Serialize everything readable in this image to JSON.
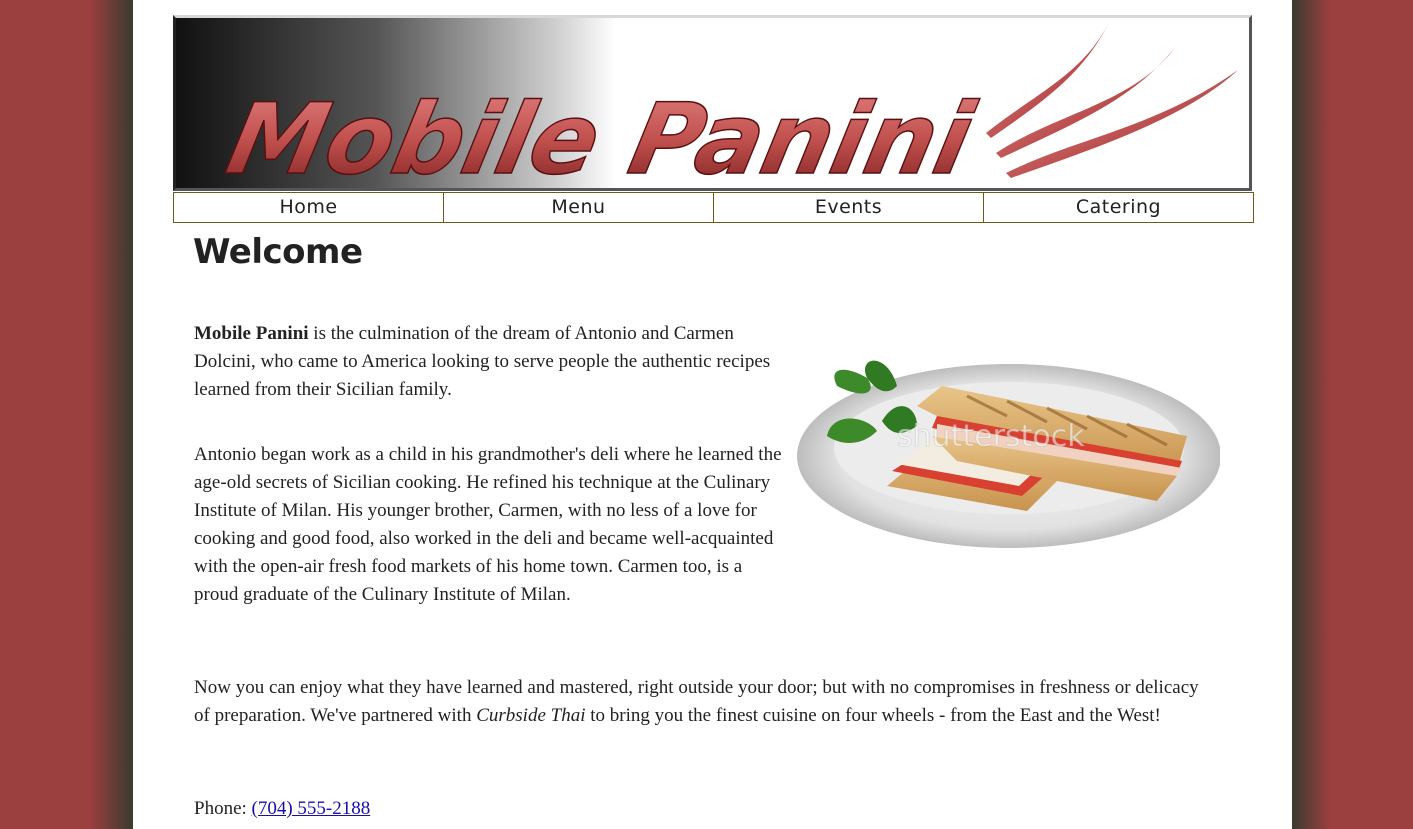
{
  "banner": {
    "logo_text": "Mobile Panini"
  },
  "nav": {
    "items": [
      {
        "label": "Home"
      },
      {
        "label": "Menu"
      },
      {
        "label": "Events"
      },
      {
        "label": "Catering"
      }
    ]
  },
  "main": {
    "title": "Welcome",
    "p1_bold": "Mobile Panini",
    "p1_rest": " is the culmination of the dream of Antonio and Carmen Dolcini, who came to America looking to serve people the authentic recipes learned from their Sicilian family.",
    "p2": "Antonio began work as a child in his grandmother's deli where he learned the age-old secrets of Sicilian cooking. He refined his technique at the Culinary Institute of Milan. His younger brother, Carmen, with no less of a love for cooking and good food, also worked in the deli and became well-acquainted with the open-air fresh food markets of his home town. Carmen too, is a proud graduate of the Culinary Institute of Milan.",
    "p3_before": "Now you can enjoy what they have learned and mastered, right outside your door; but with no compromises in freshness or delicacy of preparation. We've partnered with ",
    "p3_italic": "Curbside Thai",
    "p3_after": " to bring you the finest cuisine on four wheels - from the East and the West!",
    "phone_label": "Phone: ",
    "phone_number": "(704) 555-2188"
  },
  "photo": {
    "watermark": "shutterstock"
  },
  "colors": {
    "accent": "#c0504d",
    "side_background": "#9b3f3f",
    "nav_border": "#6b5a1e"
  }
}
